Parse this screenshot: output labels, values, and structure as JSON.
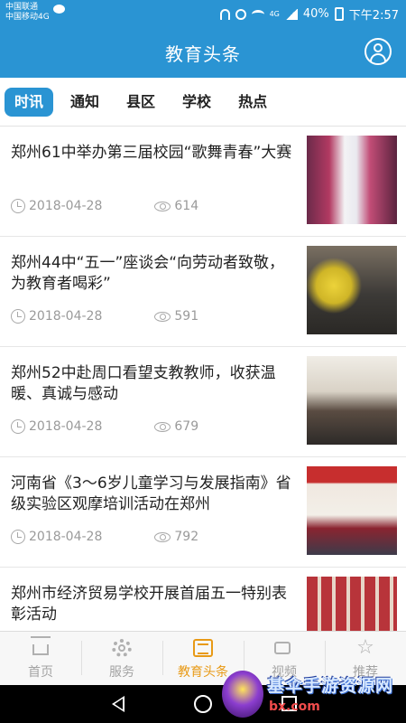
{
  "status_bar": {
    "carrier_1": "中国联通",
    "carrier_2": "中国移动4G",
    "network_small": "4G",
    "battery": "40%",
    "time": "下午2:57"
  },
  "header": {
    "title": "教育头条",
    "user_icon": "user-circle-icon"
  },
  "tabs": [
    {
      "label": "时讯",
      "active": true
    },
    {
      "label": "通知",
      "active": false
    },
    {
      "label": "县区",
      "active": false
    },
    {
      "label": "学校",
      "active": false
    },
    {
      "label": "热点",
      "active": false
    }
  ],
  "news": [
    {
      "title": "郑州61中举办第三届校园“歌舞青春”大赛",
      "date": "2018-04-28",
      "views": "614"
    },
    {
      "title": "郑州44中“五一”座谈会“向劳动者致敬，为教育者喝彩”",
      "date": "2018-04-28",
      "views": "591"
    },
    {
      "title": "郑州52中赴周口看望支教教师，收获温暖、真诚与感动",
      "date": "2018-04-28",
      "views": "679"
    },
    {
      "title": "河南省《3～6岁儿童学习与发展指南》省级实验区观摩培训活动在郑州",
      "date": "2018-04-28",
      "views": "792"
    },
    {
      "title": "郑州市经济贸易学校开展首届五一特别表彰活动",
      "date": "",
      "views": ""
    }
  ],
  "bottom_nav": [
    {
      "label": "首页",
      "icon": "home-icon",
      "active": false
    },
    {
      "label": "服务",
      "icon": "gear-icon",
      "active": false
    },
    {
      "label": "教育头条",
      "icon": "newspaper-icon",
      "active": true
    },
    {
      "label": "视频",
      "icon": "video-icon",
      "active": false
    },
    {
      "label": "推荐",
      "icon": "star-icon",
      "active": false
    }
  ],
  "watermark": {
    "text": "基伞手游资源网",
    "sub": "bx.com"
  },
  "colors": {
    "brand_blue": "#2a94d3",
    "active_orange": "#e89a16"
  }
}
